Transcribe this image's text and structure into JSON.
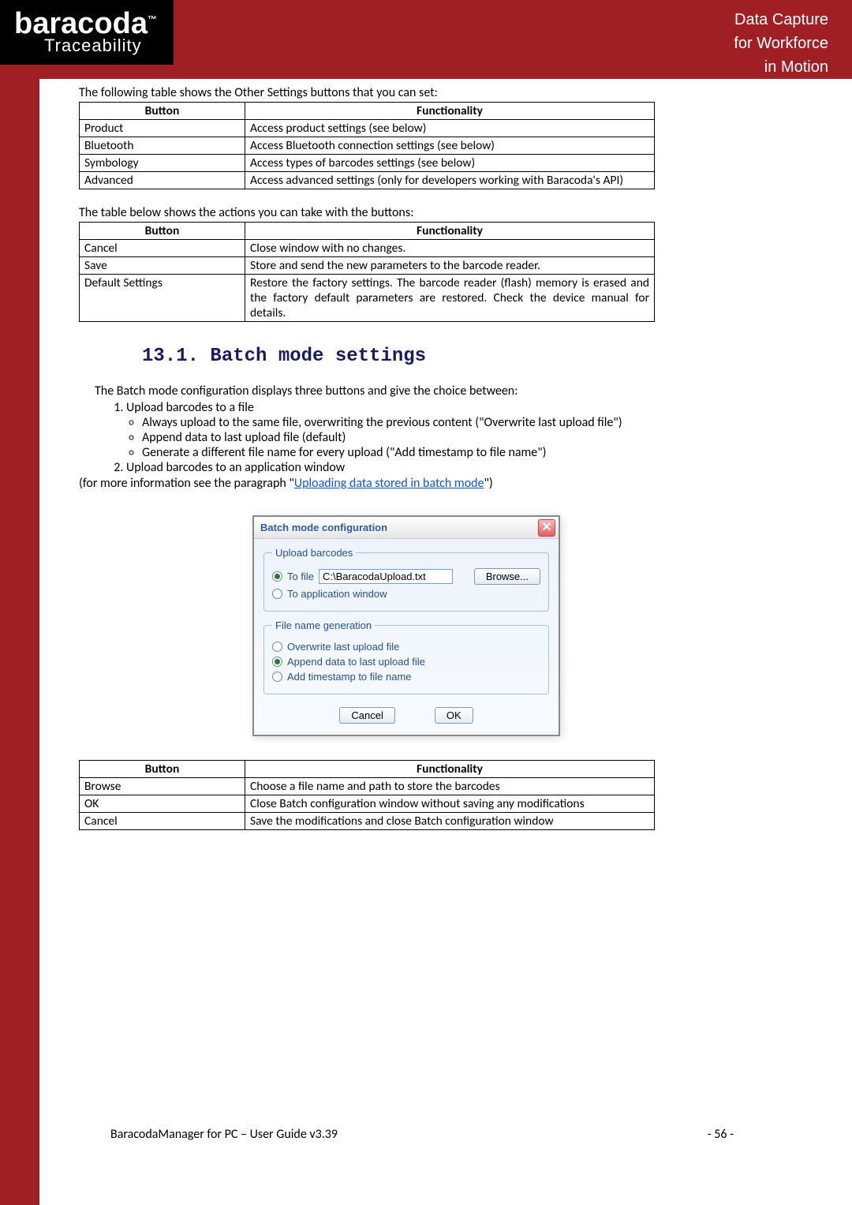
{
  "logo": {
    "main": "baracoda",
    "tm": "™",
    "sub": "Traceability"
  },
  "tagline": {
    "l1": "Data Capture",
    "l2": "for Workforce",
    "l3": "in Motion"
  },
  "intro1": "The following table shows the Other Settings buttons that you can set:",
  "intro2": "The table below shows the actions you can take with the buttons:",
  "headers": {
    "button": "Button",
    "functionality": "Functionality"
  },
  "table1": [
    {
      "b": "Product",
      "f": "Access product settings (see below)"
    },
    {
      "b": "Bluetooth",
      "f": "Access Bluetooth connection settings (see below)"
    },
    {
      "b": "Symbology",
      "f": "Access types of barcodes settings (see below)"
    },
    {
      "b": "Advanced",
      "f": "Access advanced settings (only for developers working with Baracoda's API)"
    }
  ],
  "table2": [
    {
      "b": "Cancel",
      "f": "Close window with no changes."
    },
    {
      "b": "Save",
      "f": "Store and send the new parameters to the barcode reader."
    },
    {
      "b": "Default Settings",
      "f": "Restore the factory settings. The barcode reader (flash) memory is erased and the factory default parameters are restored. Check the device manual for details."
    }
  ],
  "section_heading": "13.1. Batch mode settings",
  "body_intro": "The Batch mode configuration displays three buttons and give the choice between:",
  "list": {
    "item1": "Upload barcodes to a file",
    "sub1": "Always upload to the same file, overwriting the previous content (\"Overwrite last upload file\")",
    "sub2": "Append data to last upload file (default)",
    "sub3": "Generate a different file name for every upload (\"Add timestamp to file name\")",
    "item2": "Upload barcodes to an application window"
  },
  "ref_prefix": "(for more information see the paragraph \"",
  "ref_link": "Uploading data stored in batch mode",
  "ref_suffix": "\")",
  "dialog": {
    "title": "Batch mode configuration",
    "fs1_legend": "Upload barcodes",
    "to_file": "To file",
    "file_path": "C:\\BaracodaUpload.txt",
    "browse": "Browse...",
    "to_app": "To application window",
    "fs2_legend": "File name generation",
    "opt1": "Overwrite last upload file",
    "opt2": "Append data to last upload file",
    "opt3": "Add timestamp to file name",
    "cancel": "Cancel",
    "ok": "OK"
  },
  "table3": [
    {
      "b": "Browse",
      "f": "Choose a file name and path to store the barcodes"
    },
    {
      "b": "OK",
      "f": "Close Batch configuration window without saving any modifications"
    },
    {
      "b": "Cancel",
      "f": "Save the modifications and close Batch configuration window"
    }
  ],
  "footer": {
    "left": "BaracodaManager for PC – User Guide v3.39",
    "right": "- 56 -"
  }
}
